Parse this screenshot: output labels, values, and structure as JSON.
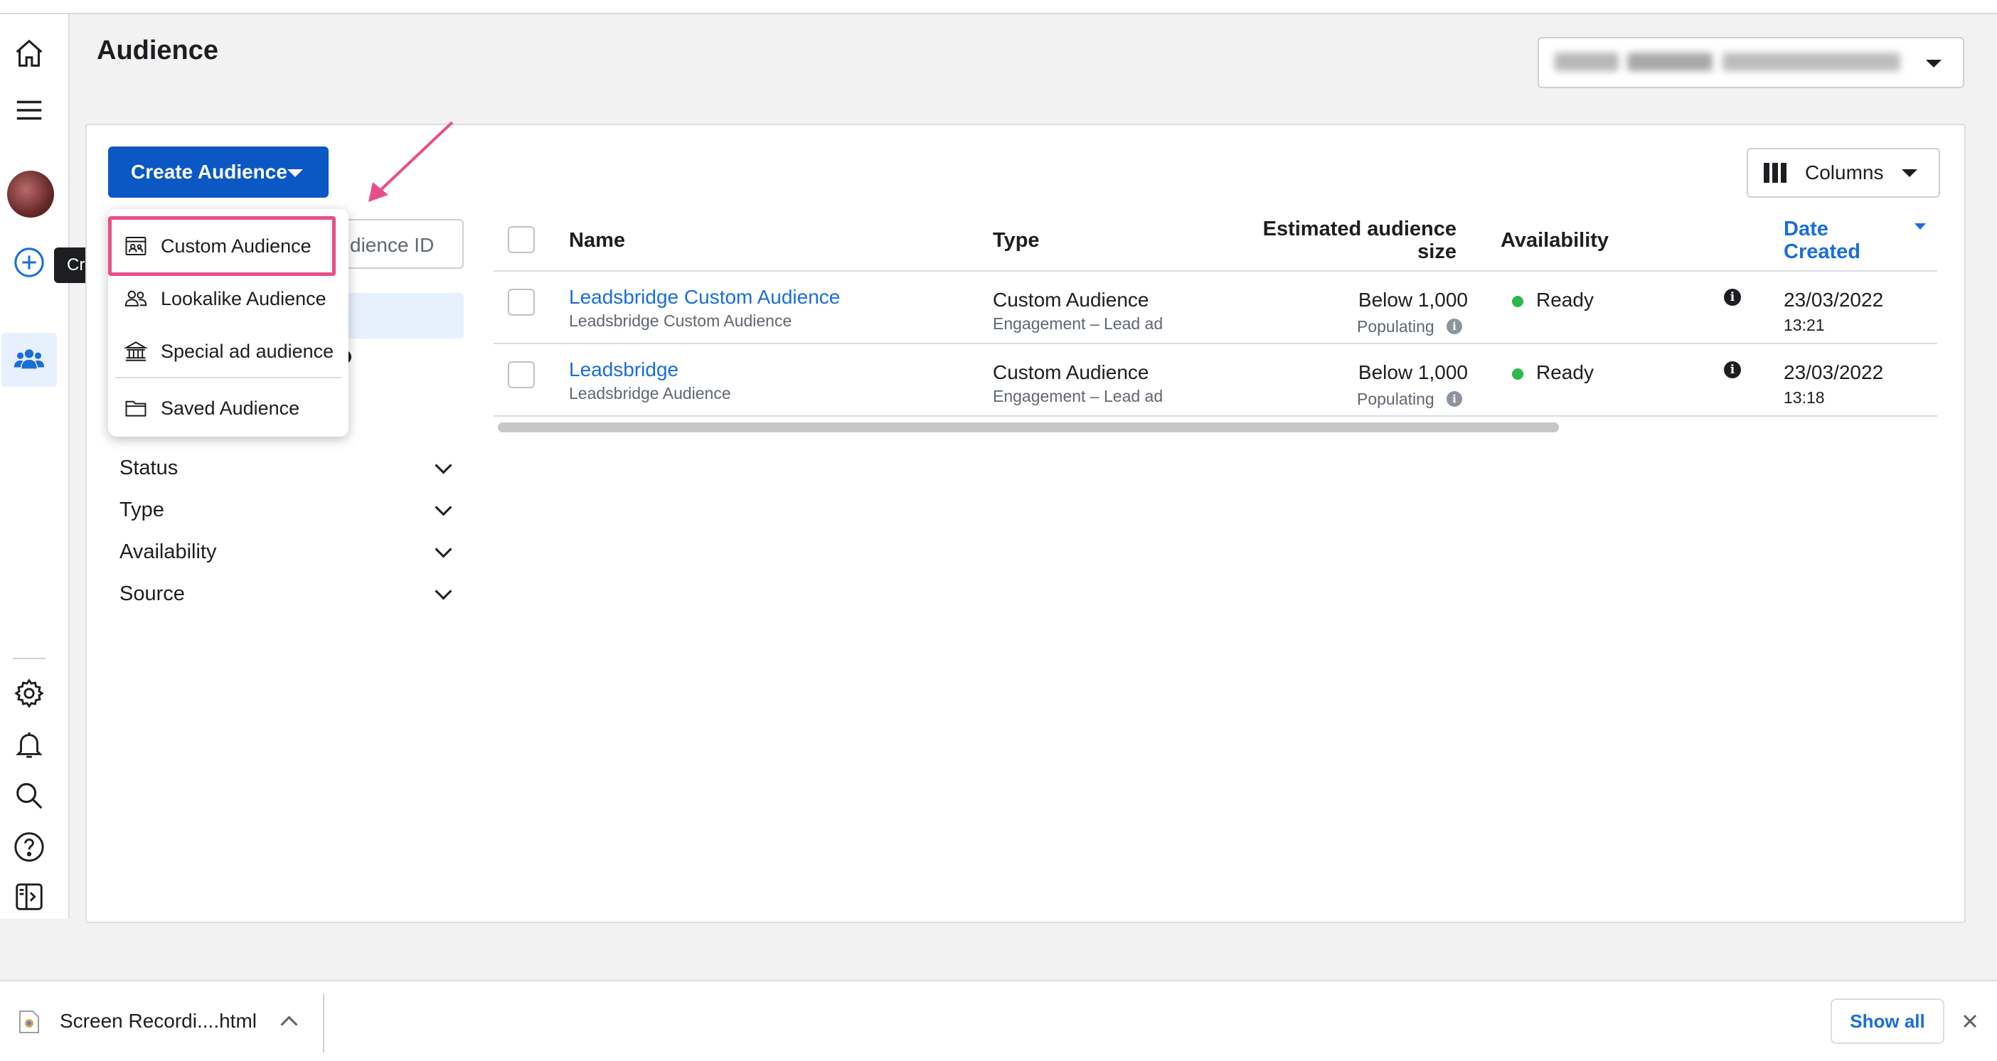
{
  "page": {
    "title": "Audience"
  },
  "left_rail": {
    "icons": [
      "home-icon",
      "menu-icon",
      "avatar",
      "create-plus-icon",
      "audience-people-icon",
      "settings-gear-icon",
      "notification-bell-icon",
      "search-icon",
      "help-icon",
      "panel-toggle-icon"
    ],
    "tooltip": "Create"
  },
  "toolbar": {
    "create_label": "Create Audience",
    "columns_label": "Columns"
  },
  "search": {
    "placeholder_visible": "dience ID"
  },
  "create_menu": {
    "items": [
      {
        "label": "Custom Audience",
        "icon": "custom-audience-icon",
        "highlighted": true
      },
      {
        "label": "Lookalike Audience",
        "icon": "lookalike-people-icon"
      },
      {
        "label": "Special ad audience",
        "icon": "bank-building-icon"
      },
      {
        "label": "Saved Audience",
        "icon": "folder-icon"
      }
    ]
  },
  "filters": [
    {
      "label": "Status"
    },
    {
      "label": "Type"
    },
    {
      "label": "Availability"
    },
    {
      "label": "Source"
    }
  ],
  "table": {
    "headers": {
      "name": "Name",
      "type": "Type",
      "size_line1": "Estimated audience",
      "size_line2": "size",
      "availability": "Availability",
      "date_line1": "Date",
      "date_line2": "Created"
    },
    "rows": [
      {
        "name": "Leadsbridge Custom Audience",
        "name_sub": "Leadsbridge Custom Audience",
        "type": "Custom Audience",
        "type_sub": "Engagement – Lead ad",
        "size": "Below 1,000",
        "size_sub": "Populating",
        "availability": "Ready",
        "date": "23/03/2022",
        "time": "13:21"
      },
      {
        "name": "Leadsbridge",
        "name_sub": "Leadsbridge Audience",
        "type": "Custom Audience",
        "type_sub": "Engagement – Lead ad",
        "size": "Below 1,000",
        "size_sub": "Populating",
        "availability": "Ready",
        "date": "23/03/2022",
        "time": "13:18"
      }
    ]
  },
  "download_bar": {
    "file_name": "Screen Recordi....html",
    "show_all": "Show all"
  },
  "colors": {
    "primary_button": "#0b57c4",
    "link": "#1a6ed8",
    "highlight_box": "#e84f8a",
    "ready_dot": "#2db84d"
  }
}
